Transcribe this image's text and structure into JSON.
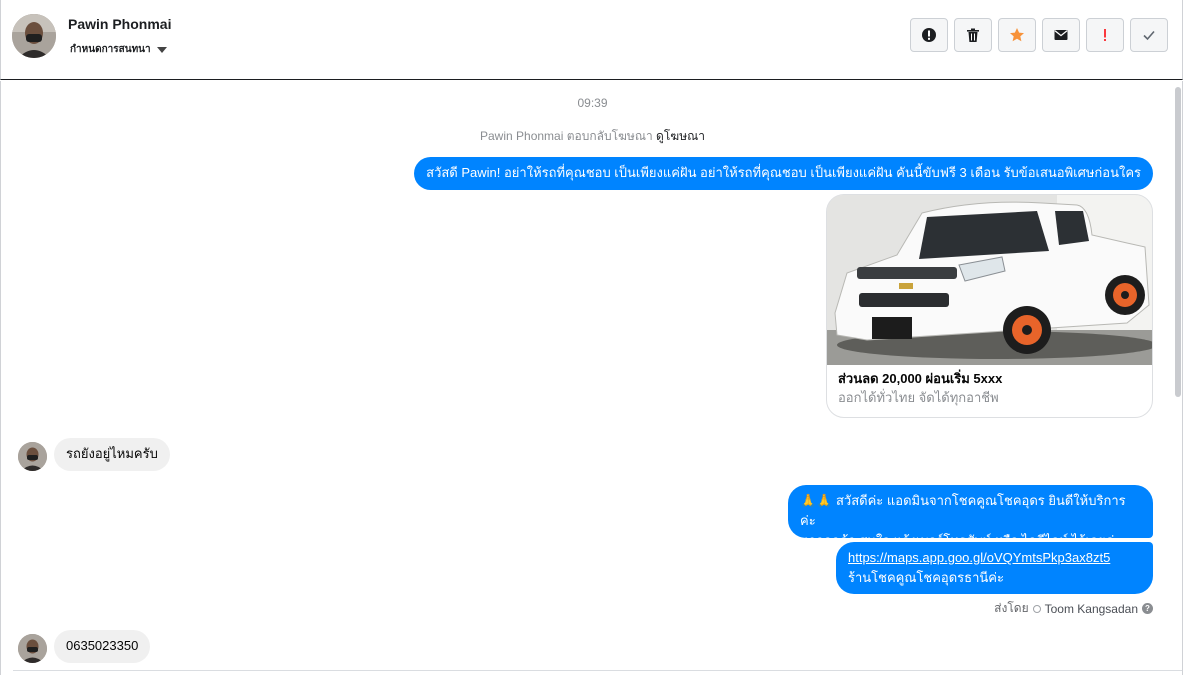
{
  "header": {
    "contact_name": "Pawin Phonmai",
    "assign_label": "กำหนดการสนทนา",
    "actions": [
      {
        "icon": "alert-circle-icon",
        "name": "mark-spam-button"
      },
      {
        "icon": "trash-icon",
        "name": "delete-button"
      },
      {
        "icon": "star-icon",
        "name": "star-button"
      },
      {
        "icon": "envelope-icon",
        "name": "mark-unread-button"
      },
      {
        "icon": "exclamation-icon",
        "name": "follow-up-button"
      },
      {
        "icon": "check-icon",
        "name": "mark-done-button"
      }
    ]
  },
  "thread": {
    "timestamp": "09:39",
    "ad_reply_prefix": "Pawin Phonmai ตอบกลับโฆษณา",
    "ad_reply_link": "ดูโฆษณา",
    "messages": {
      "greeting": "สวัสดี Pawin! อย่าให้รถที่คุณชอบ เป็นเพียงแค่ฝัน อย่าให้รถที่คุณชอบ เป็นเพียงแค่ฝัน คันนี้ขับฟรี 3 เดือน รับข้อเสนอพิเศษก่อนใคร",
      "card_title": "ส่วนลด 20,000 ผ่อนเริ่ม 5xxx",
      "card_subtitle": "ออกได้ทั่วไทย จัดได้ทุกอาชีพ",
      "customer_question": "รถยังอยู่ไหมครับ",
      "reply_line1": "🙏🙏 สวัสดีค่ะ แอดมินจากโชคคูณโชคอุดร ยินดีให้บริการค่ะ",
      "reply_line2": "หากลูกค้า สนใจ แจ้งเบอร์โทรศัพท์ หรือ ไอดีไลน์  ไว้เลยค่ะ",
      "map_url": "https://maps.app.goo.gl/oVQYmtsPkp3ax8zt5",
      "map_caption": "ร้านโชคคูณโชคอุดรธานีค่ะ",
      "sent_by_label": "ส่งโดย",
      "sent_by_agent": "Toom Kangsadan",
      "customer_phone": "0635023350"
    }
  },
  "colors": {
    "accent_blue": "#0084ff",
    "incoming_bubble": "#f0f0f0",
    "star": "#f7923a",
    "alert_red": "#fa383e"
  }
}
